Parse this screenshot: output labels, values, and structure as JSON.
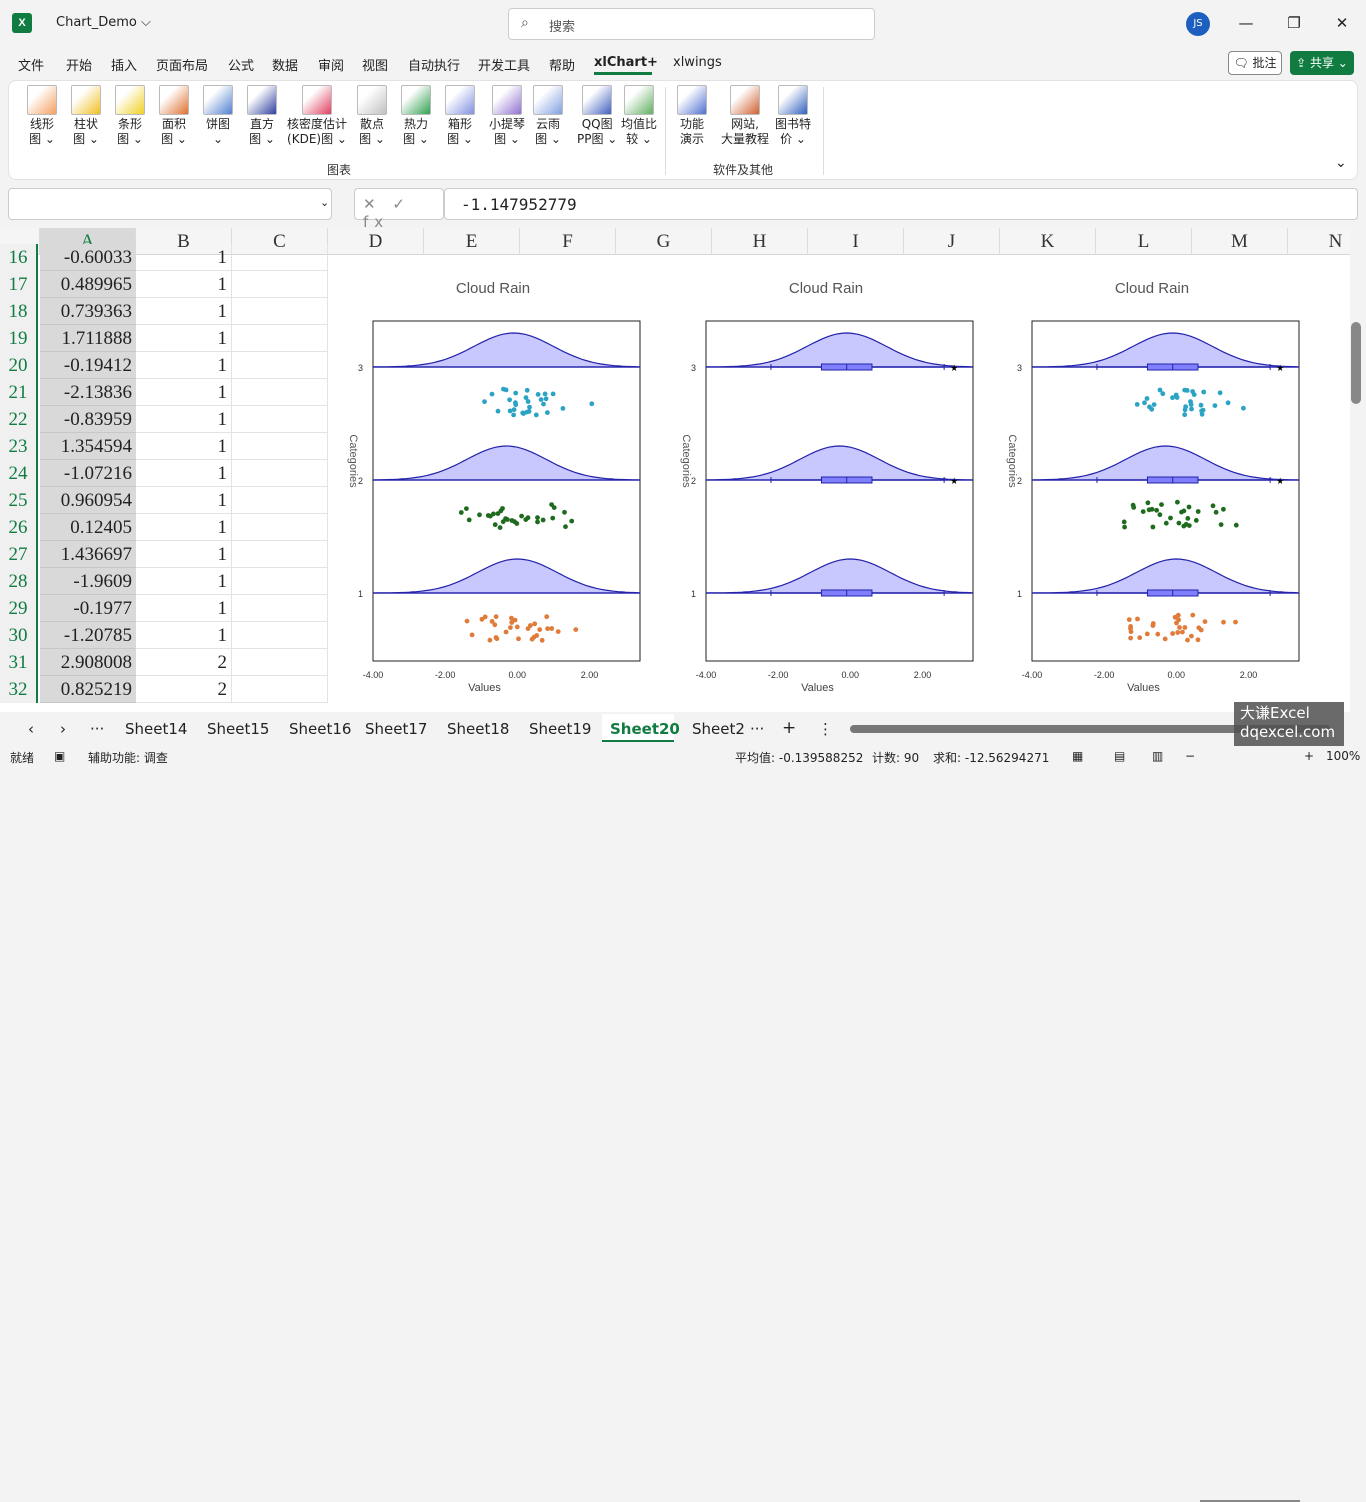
{
  "app": {
    "logo_text": "X",
    "doc_title": "Chart_Demo ⌵",
    "search_placeholder": "搜索",
    "avatar": "JS"
  },
  "window": {
    "minimize": "—",
    "restore": "❐",
    "close": "✕"
  },
  "menu": [
    "文件",
    "开始",
    "插入",
    "页面布局",
    "公式",
    "数据",
    "审阅",
    "视图",
    "自动执行",
    "开发工具",
    "帮助",
    "xlChart+",
    "xlwings"
  ],
  "menu_active": "xlChart+",
  "comment_button": "🗨 批注",
  "share_button": "⇪ 共享 ⌄",
  "ribbon": {
    "buttons": [
      {
        "label": "线形\n图 ⌄",
        "icon": "line-chart-icon"
      },
      {
        "label": "柱状\n图 ⌄",
        "icon": "column-chart-icon"
      },
      {
        "label": "条形\n图 ⌄",
        "icon": "bar-chart-icon"
      },
      {
        "label": "面积\n图 ⌄",
        "icon": "area-chart-icon"
      },
      {
        "label": "饼图\n⌄",
        "icon": "pie-chart-icon"
      },
      {
        "label": "直方\n图 ⌄",
        "icon": "histogram-icon"
      },
      {
        "label": "核密度估计\n(KDE)图 ⌄",
        "icon": "kde-icon"
      },
      {
        "label": "散点\n图 ⌄",
        "icon": "scatter-icon"
      },
      {
        "label": "热力\n图 ⌄",
        "icon": "heatmap-icon"
      },
      {
        "label": "箱形\n图 ⌄",
        "icon": "boxplot-icon"
      },
      {
        "label": "小提琴\n图 ⌄",
        "icon": "violin-icon"
      },
      {
        "label": "云雨\n图 ⌄",
        "icon": "raincloud-icon"
      },
      {
        "label": "QQ图\nPP图 ⌄",
        "icon": "qq-icon"
      },
      {
        "label": "均值比\n较 ⌄",
        "icon": "mean-compare-icon"
      },
      {
        "label": "功能\n演示",
        "icon": "demo-icon"
      },
      {
        "label": "网站,\n大量教程",
        "icon": "website-icon"
      },
      {
        "label": "图书特\n价 ⌄",
        "icon": "book-icon"
      }
    ],
    "group1": "图表",
    "group2": "软件及其他",
    "collapse": "⌄"
  },
  "formula": {
    "namebox": "",
    "value": "-1.147952779",
    "fx": "✕ ✓ fx"
  },
  "columns": [
    "A",
    "B",
    "C",
    "D",
    "E",
    "F",
    "G",
    "H",
    "I",
    "J",
    "K",
    "L",
    "M",
    "N"
  ],
  "rows": [
    {
      "n": "16",
      "a": "-0.60033",
      "b": "1"
    },
    {
      "n": "17",
      "a": "0.489965",
      "b": "1"
    },
    {
      "n": "18",
      "a": "0.739363",
      "b": "1"
    },
    {
      "n": "19",
      "a": "1.711888",
      "b": "1"
    },
    {
      "n": "20",
      "a": "-0.19412",
      "b": "1"
    },
    {
      "n": "21",
      "a": "-2.13836",
      "b": "1"
    },
    {
      "n": "22",
      "a": "-0.83959",
      "b": "1"
    },
    {
      "n": "23",
      "a": "1.354594",
      "b": "1"
    },
    {
      "n": "24",
      "a": "-1.07216",
      "b": "1"
    },
    {
      "n": "25",
      "a": "0.960954",
      "b": "1"
    },
    {
      "n": "26",
      "a": "0.12405",
      "b": "1"
    },
    {
      "n": "27",
      "a": "1.436697",
      "b": "1"
    },
    {
      "n": "28",
      "a": "-1.9609",
      "b": "1"
    },
    {
      "n": "29",
      "a": "-0.1977",
      "b": "1"
    },
    {
      "n": "30",
      "a": "-1.20785",
      "b": "1"
    },
    {
      "n": "31",
      "a": "2.908008",
      "b": "2"
    },
    {
      "n": "32",
      "a": "0.825219",
      "b": "2"
    }
  ],
  "chart_data": [
    {
      "type": "scatter",
      "title": "Cloud Rain",
      "xlabel": "Values",
      "ylabel": "Categories",
      "xlim": [
        -4,
        3.4
      ],
      "xticks": [
        "-4.00",
        "-2.00",
        "0.00",
        "2.00"
      ],
      "yticks": [
        "1",
        "2",
        "3"
      ],
      "show_box": false,
      "show_points": true
    },
    {
      "type": "scatter",
      "title": "Cloud Rain",
      "xlabel": "Values",
      "ylabel": "Categories",
      "xlim": [
        -4,
        3.4
      ],
      "xticks": [
        "-4.00",
        "-2.00",
        "0.00",
        "2.00"
      ],
      "yticks": [
        "1",
        "2",
        "3"
      ],
      "show_box": true,
      "show_points": false
    },
    {
      "type": "scatter",
      "title": "Cloud Rain",
      "xlabel": "Values",
      "ylabel": "Categories",
      "xlim": [
        -4,
        3.4
      ],
      "xticks": [
        "-4.00",
        "-2.00",
        "0.00",
        "2.00"
      ],
      "yticks": [
        "1",
        "2",
        "3"
      ],
      "show_box": true,
      "show_points": true
    }
  ],
  "series_colors": {
    "1": "#e07b39",
    "2": "#1e6b1e",
    "3": "#2aa3c4",
    "cloud_fill": "#c8c8ff",
    "cloud_line": "#2222aa",
    "box_fill": "#8080ff"
  },
  "tabs": [
    "Sheet14",
    "Sheet15",
    "Sheet16",
    "Sheet17",
    "Sheet18",
    "Sheet19",
    "Sheet20",
    "Sheet2"
  ],
  "active_tab": "Sheet20",
  "status": {
    "ready": "就绪",
    "accessibility": "辅助功能: 调查",
    "avg": "平均值: -0.139588252",
    "count": "计数: 90",
    "sum": "求和: -12.56294271",
    "zoom": "100%"
  },
  "watermark": "大谦Excel\ndqexcel.com"
}
